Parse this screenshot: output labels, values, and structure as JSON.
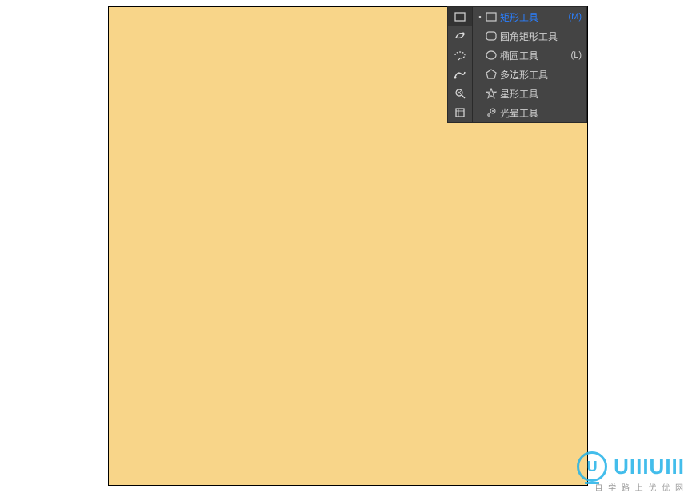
{
  "canvas": {
    "fill": "#f8d589"
  },
  "toolbar": {
    "vertical_tools": [
      {
        "name": "rectangle-tool",
        "active": true
      },
      {
        "name": "live-paint-tool",
        "active": false
      },
      {
        "name": "lasso-tool",
        "active": false
      },
      {
        "name": "blob-brush-tool",
        "active": false
      },
      {
        "name": "color-guide-tool",
        "active": false
      },
      {
        "name": "artboard-tool",
        "active": false
      }
    ],
    "flyout": [
      {
        "label": "矩形工具",
        "shortcut": "(M)",
        "icon": "rect",
        "selected": true
      },
      {
        "label": "圆角矩形工具",
        "shortcut": "",
        "icon": "roundrect",
        "selected": false
      },
      {
        "label": "椭圆工具",
        "shortcut": "(L)",
        "icon": "ellipse",
        "selected": false
      },
      {
        "label": "多边形工具",
        "shortcut": "",
        "icon": "polygon",
        "selected": false
      },
      {
        "label": "星形工具",
        "shortcut": "",
        "icon": "star",
        "selected": false
      },
      {
        "label": "光晕工具",
        "shortcut": "",
        "icon": "flare",
        "selected": false
      }
    ]
  },
  "watermark": {
    "brand": "UIIIUIII",
    "subtitle": "自 学 路 上 优 优 网"
  }
}
